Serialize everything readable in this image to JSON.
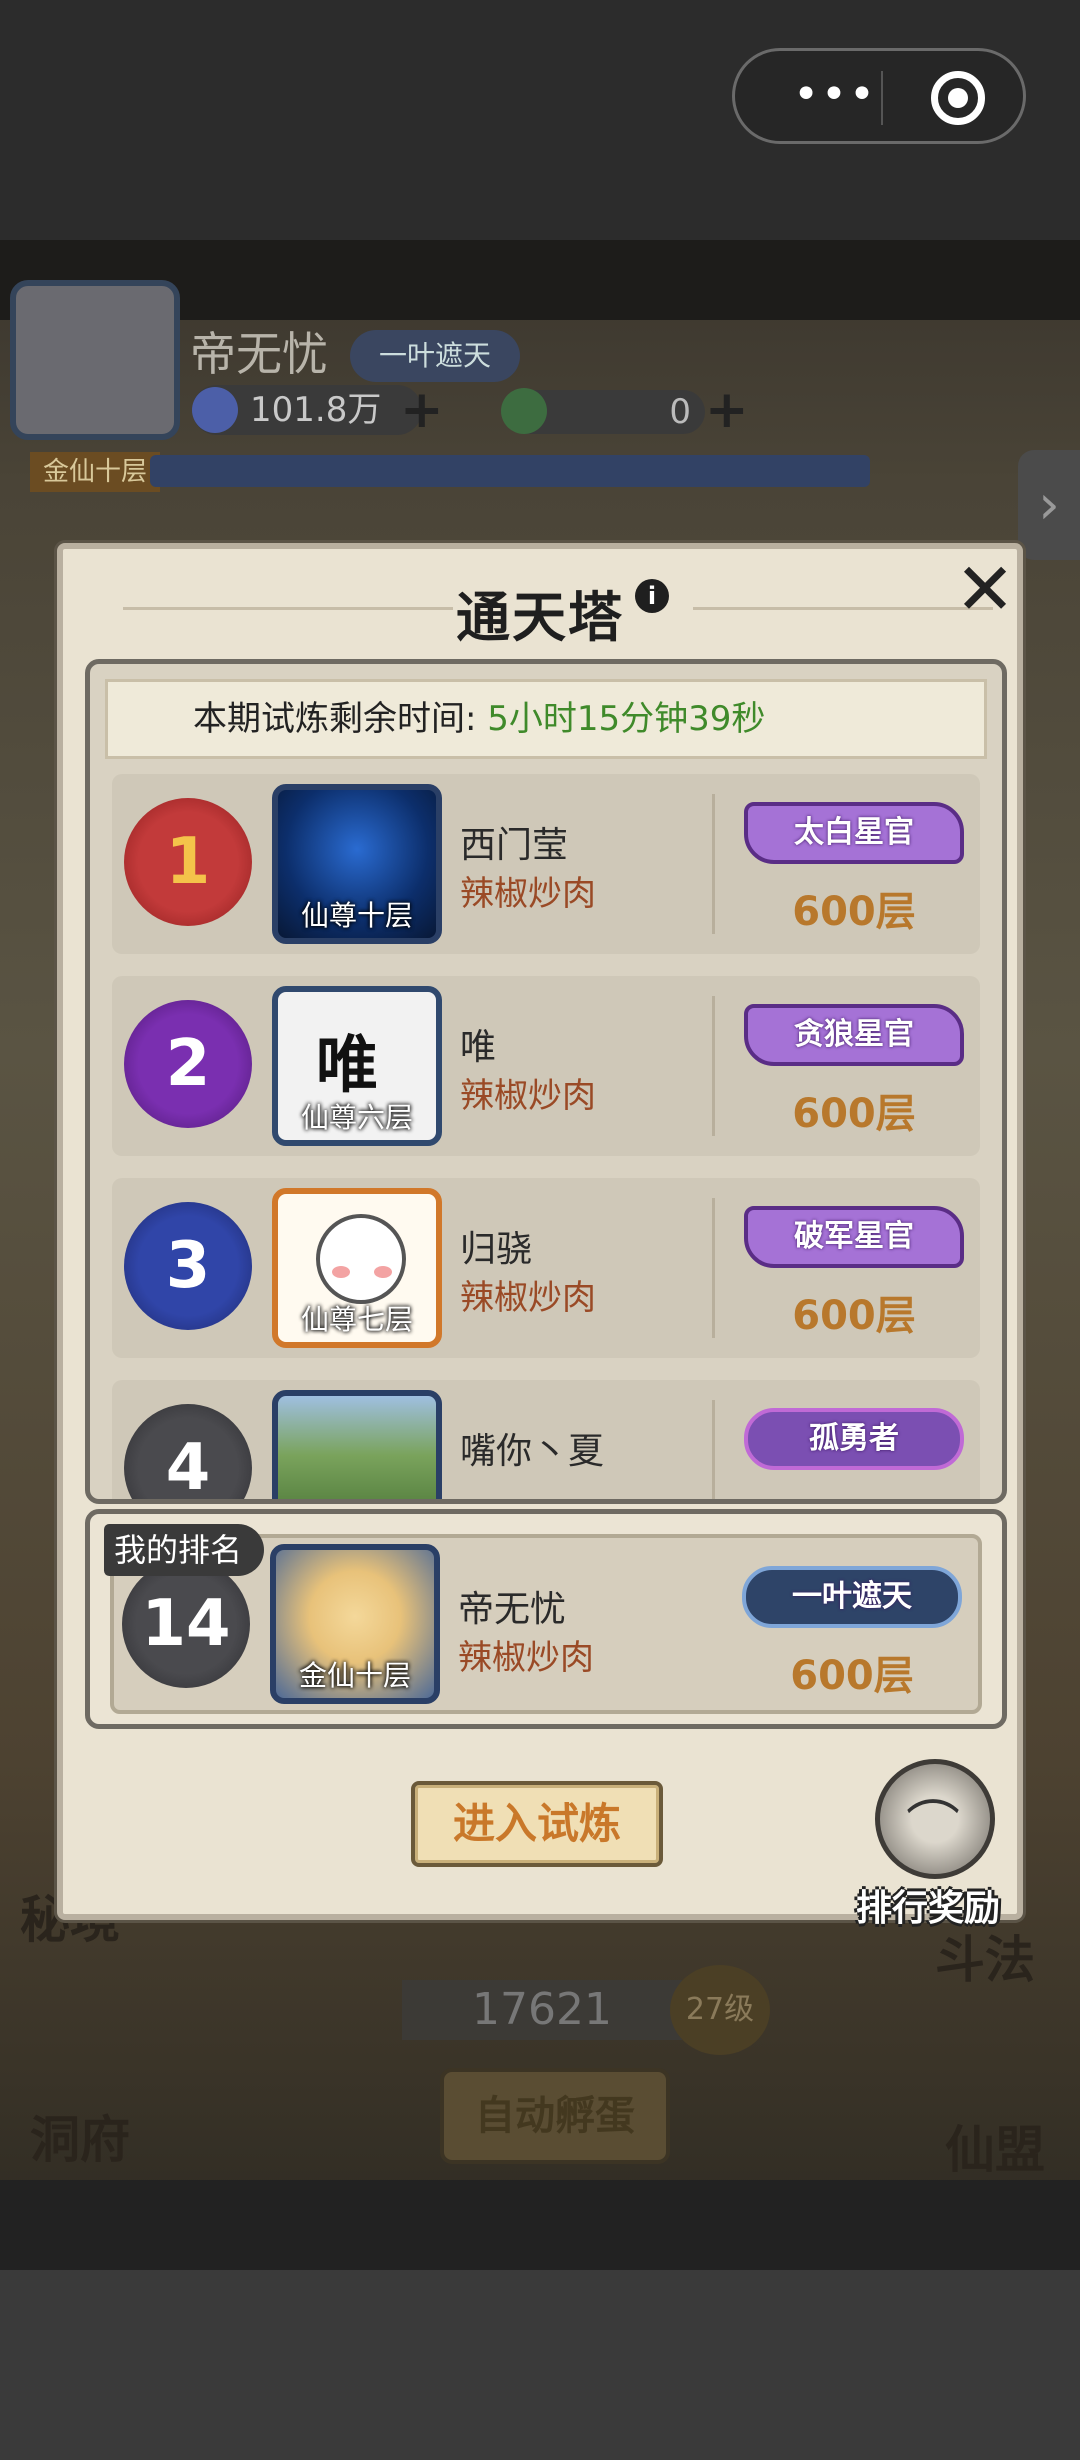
{
  "background": {
    "player_name": "帝无忧",
    "player_title": "一叶遮天",
    "coins": "101.8万",
    "jade": "0",
    "player_level": "金仙十层",
    "side_labels": {
      "left_1": "秘境",
      "left_2": "洞府",
      "right_1": "斗法",
      "right_2": "仙盟"
    },
    "score": "17621",
    "score_level": "27级",
    "auto_button": "自动孵蛋"
  },
  "modal": {
    "title": "通天塔",
    "timer_label": "本期试炼剩余时间: ",
    "timer_value": "5小时15分钟39秒",
    "rankings": [
      {
        "rank": "1",
        "avatar_caption": "仙尊十层",
        "name": "西门莹",
        "server": "辣椒炒肉",
        "title": "太白星官",
        "floors": "600层"
      },
      {
        "rank": "2",
        "avatar_caption": "仙尊六层",
        "name": "唯",
        "server": "辣椒炒肉",
        "title": "贪狼星官",
        "floors": "600层"
      },
      {
        "rank": "3",
        "avatar_caption": "仙尊七层",
        "name": "归骁",
        "server": "辣椒炒肉",
        "title": "破军星官",
        "floors": "600层"
      },
      {
        "rank": "4",
        "avatar_caption": "",
        "name": "嘴你丶夏",
        "server": "",
        "title": "孤勇者",
        "floors": ""
      }
    ],
    "my_rank": {
      "tag": "我的排名",
      "rank": "14",
      "avatar_caption": "金仙十层",
      "name": "帝无忧",
      "server": "辣椒炒肉",
      "title": "一叶遮天",
      "floors": "600层"
    },
    "enter_button": "进入试炼",
    "reward_button": "排行奖励"
  },
  "colors": {
    "timer_green": "#3f8a2a",
    "floors_gold": "#b8782c",
    "server_red": "#9a4a26",
    "badge_purple": "#a572d6"
  },
  "icons": [
    "more-dots-icon",
    "record-icon",
    "info-icon",
    "close-icon",
    "reward-bag-icon"
  ]
}
